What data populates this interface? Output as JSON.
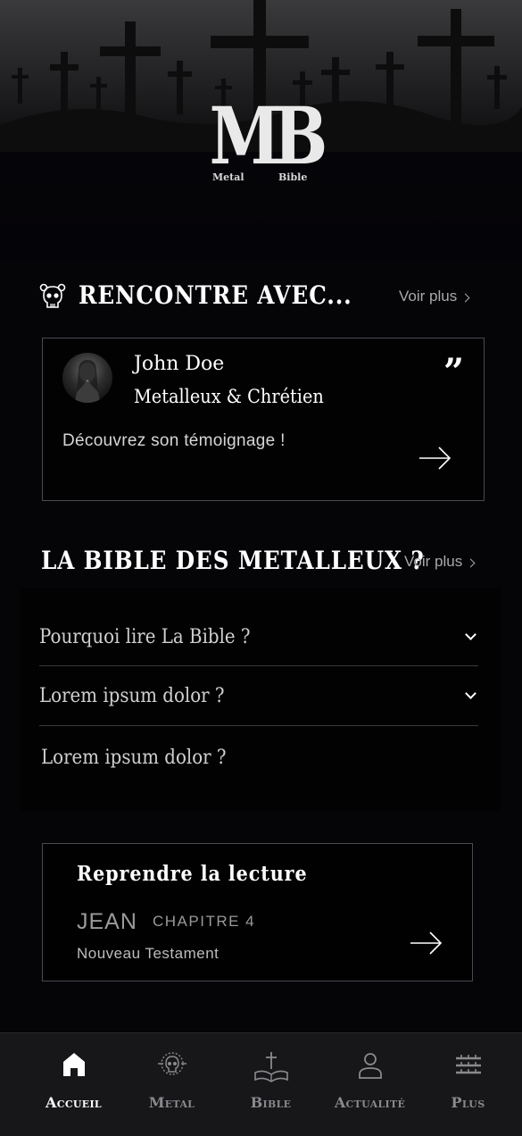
{
  "logo": {
    "main": "MB",
    "left": "Metal",
    "right": "Bible"
  },
  "meet": {
    "title": "Rencontre avec...",
    "see_more": "Voir plus",
    "name": "John Doe",
    "role": "Metalleux & Chrétien",
    "description": "Découvrez son témoignage !"
  },
  "bible": {
    "title": "La Bible des Metalleux ?",
    "see_more": "Voir plus",
    "faq": [
      {
        "question": "Pourquoi lire La Bible ?"
      },
      {
        "question": "Lorem ipsum dolor ?"
      },
      {
        "question": "Lorem ipsum dolor ?"
      }
    ]
  },
  "reading": {
    "title": "Reprendre la lecture",
    "book": "JEAN",
    "chapter": "CHAPITRE 4",
    "testament": "Nouveau Testament"
  },
  "tabs": [
    {
      "label": "Accueil",
      "icon": "home-icon",
      "active": true
    },
    {
      "label": "Metal",
      "icon": "skull-icon",
      "active": false
    },
    {
      "label": "Bible",
      "icon": "bible-icon",
      "active": false
    },
    {
      "label": "Actualité",
      "icon": "user-icon",
      "active": false
    },
    {
      "label": "Plus",
      "icon": "grid-icon",
      "active": false
    }
  ],
  "colors": {
    "background": "#050407",
    "card_border": "#4a4a4f",
    "tabbar": "#17171a",
    "active_tab": "#ffffff",
    "inactive_tab": "#8a8a8e"
  }
}
